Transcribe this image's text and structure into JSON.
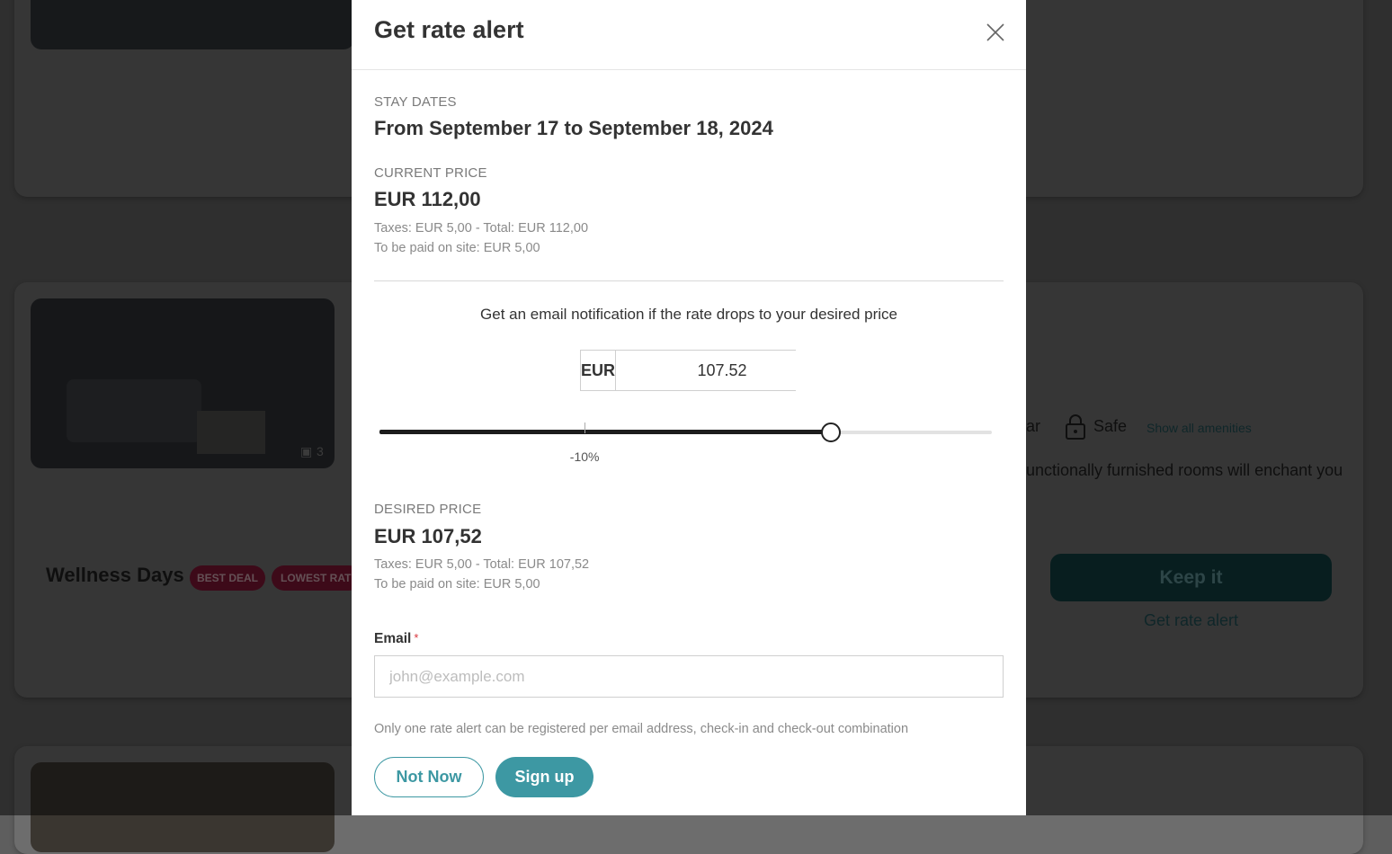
{
  "background": {
    "card2": {
      "title": "Wellness Days",
      "badges": [
        "BEST DEAL",
        "LOWEST RAT"
      ],
      "photo_count": "3",
      "amenity_partial": "ar",
      "amenity_safe": "Safe",
      "show_all_amenities": "Show all amenities",
      "description_partial": "unctionally furnished rooms will enchant you",
      "keep_button": "Keep it",
      "rate_alert_link": "Get rate alert"
    }
  },
  "modal": {
    "title": "Get rate alert",
    "stay": {
      "label": "STAY DATES",
      "value": "From September 17 to September 18, 2024"
    },
    "current": {
      "label": "CURRENT PRICE",
      "price": "EUR 112,00",
      "taxes": "Taxes: EUR 5,00 - Total: EUR 112,00",
      "onsite": "To be paid on site: EUR 5,00"
    },
    "notification_text": "Get an email notification if the rate drops to your desired price",
    "currency": "EUR",
    "amount": "107.52",
    "slider": {
      "fraction": 0.737,
      "tick_fraction": 0.335,
      "tick_label": "-10%"
    },
    "desired": {
      "label": "DESIRED PRICE",
      "price": "EUR 107,52",
      "taxes": "Taxes: EUR 5,00 - Total: EUR 107,52",
      "onsite": "To be paid on site: EUR 5,00"
    },
    "email": {
      "label": "Email",
      "required_mark": "*",
      "placeholder": "john@example.com"
    },
    "notice": "Only one rate alert can be registered per email address, check-in and check-out combination",
    "buttons": {
      "not_now": "Not Now",
      "sign_up": "Sign up"
    }
  },
  "colors": {
    "accent": "#3d98a3",
    "required": "#d9363e",
    "badge": "#c2185b",
    "keep_button": "#1f7a80"
  },
  "icons": [
    "close-icon",
    "safe-lock-icon",
    "gallery-icon"
  ]
}
